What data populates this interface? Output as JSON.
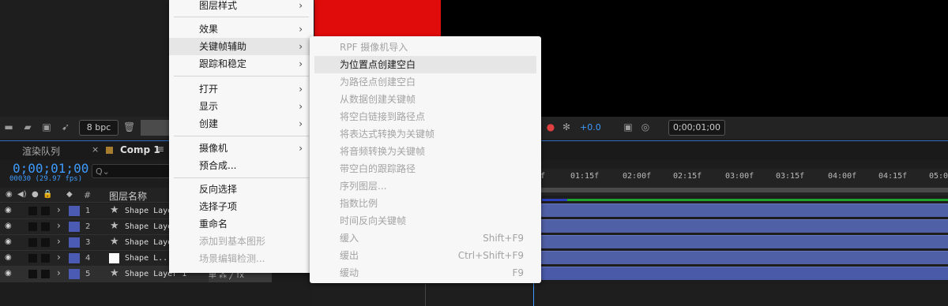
{
  "viewer_toolbar": {
    "bpc": "8 bpc",
    "exposure": "+0.0",
    "timecode": "0;00;01;00"
  },
  "tabs": {
    "render_queue": "渲染队列",
    "close": "×",
    "comp": "Comp 1",
    "menu": "≡"
  },
  "timeline": {
    "current_time": "0;00;01;00",
    "fps_info": "00030 (29.97 fps)",
    "search_placeholder": "Q⌄",
    "header": {
      "num": "#",
      "name": "图层名称"
    },
    "ticks": [
      "f",
      "01:15f",
      "02:00f",
      "02:15f",
      "03:00f",
      "03:15f",
      "04:00f",
      "04:15f",
      "05:0"
    ],
    "row5_switch": "单 ⁂ ╱ fx"
  },
  "layers": [
    {
      "num": "1",
      "name": "Shape Layer",
      "type": "star"
    },
    {
      "num": "2",
      "name": "Shape Layer",
      "type": "star"
    },
    {
      "num": "3",
      "name": "Shape Laye",
      "type": "star"
    },
    {
      "num": "4",
      "name": "Shape L...",
      "type": "solid"
    },
    {
      "num": "5",
      "name": "Shape Layer 1",
      "type": "star"
    }
  ],
  "context_menu": [
    {
      "label": "图层样式",
      "arrow": "›"
    },
    {
      "label": "效果",
      "arrow": "›"
    },
    {
      "label": "关键帧辅助",
      "arrow": "›"
    },
    {
      "label": "跟踪和稳定",
      "arrow": "›"
    },
    {
      "label": "打开",
      "arrow": "›"
    },
    {
      "label": "显示",
      "arrow": "›"
    },
    {
      "label": "创建",
      "arrow": "›"
    },
    {
      "label": "摄像机",
      "arrow": "›"
    },
    {
      "label": "预合成..."
    },
    {
      "label": "反向选择"
    },
    {
      "label": "选择子项"
    },
    {
      "label": "重命名"
    },
    {
      "label": "添加到基本图形"
    },
    {
      "label": "场景编辑检测..."
    }
  ],
  "submenu": [
    {
      "label": "RPF 摄像机导入"
    },
    {
      "label": "为位置点创建空白"
    },
    {
      "label": "为路径点创建空白"
    },
    {
      "label": "从数据创建关键帧"
    },
    {
      "label": "将空白链接到路径点"
    },
    {
      "label": "将表达式转换为关键帧"
    },
    {
      "label": "将音频转换为关键帧"
    },
    {
      "label": "带空白的跟踪路径"
    },
    {
      "label": "序列图层..."
    },
    {
      "label": "指数比例"
    },
    {
      "label": "时间反向关键帧"
    },
    {
      "label": "缓入",
      "shortcut": "Shift+F9"
    },
    {
      "label": "缓出",
      "shortcut": "Ctrl+Shift+F9"
    },
    {
      "label": "缓动",
      "shortcut": "F9"
    }
  ]
}
